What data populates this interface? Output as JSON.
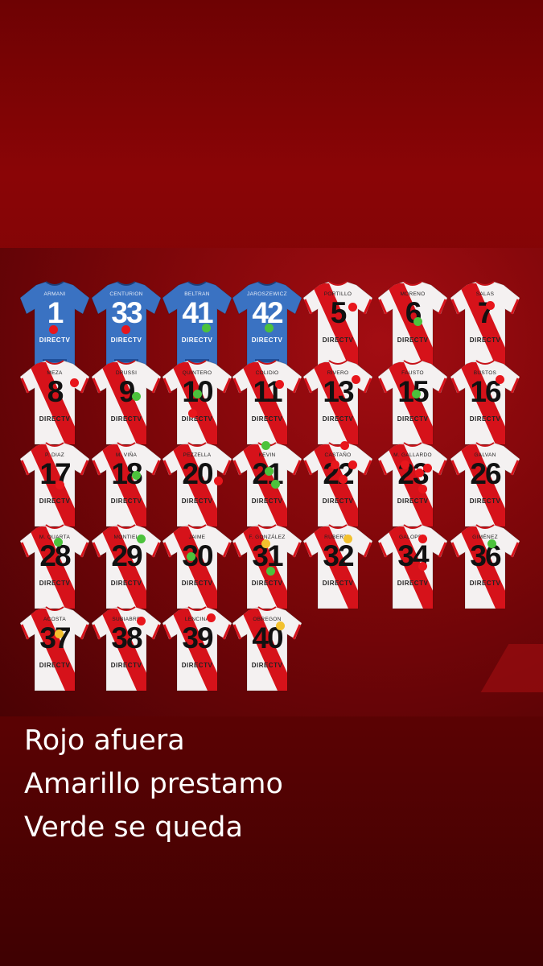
{
  "colors": {
    "red_dot": "#e8161c",
    "yellow_dot": "#f2c12e",
    "green_dot": "#4cc23c",
    "blue_kit": "#3a72c2",
    "white_kit": "#f4f1f1",
    "red_sash": "#d6121a"
  },
  "sponsor": "DIRECTV",
  "legend": {
    "red": "Rojo afuera",
    "yellow": "Amarillo prestamo",
    "green": "Verde se queda"
  },
  "jerseys": [
    {
      "name": "ARMANI",
      "number": "1",
      "kit": "blue",
      "dots": [
        "red"
      ]
    },
    {
      "name": "CENTURION",
      "number": "33",
      "kit": "blue",
      "dots": [
        "red"
      ]
    },
    {
      "name": "BELTRAN",
      "number": "41",
      "kit": "blue",
      "dots": [
        "green"
      ]
    },
    {
      "name": "JAROSZEWICZ",
      "number": "42",
      "kit": "blue",
      "dots": [
        "green"
      ]
    },
    {
      "name": "PORTILLO",
      "number": "5",
      "kit": "white",
      "dots": [
        "red"
      ]
    },
    {
      "name": "MORENO",
      "number": "6",
      "kit": "white",
      "dots": [
        "green"
      ]
    },
    {
      "name": "SALAS",
      "number": "7",
      "kit": "white",
      "dots": [
        "red"
      ]
    },
    {
      "name": "MEZA",
      "number": "8",
      "kit": "white",
      "dots": [
        "red"
      ]
    },
    {
      "name": "DRUSSI",
      "number": "9",
      "kit": "white",
      "dots": [
        "green"
      ]
    },
    {
      "name": "QUINTERO",
      "number": "10",
      "kit": "white",
      "dots": [
        "green",
        "red"
      ]
    },
    {
      "name": "COLIDIO",
      "number": "11",
      "kit": "white",
      "dots": [
        "red"
      ]
    },
    {
      "name": "RIVERO",
      "number": "13",
      "kit": "white",
      "dots": [
        "red"
      ]
    },
    {
      "name": "FAUSTO",
      "number": "15",
      "kit": "white",
      "dots": [
        "green"
      ]
    },
    {
      "name": "BUSTOS",
      "number": "16",
      "kit": "white",
      "dots": [
        "red"
      ]
    },
    {
      "name": "P. DIAZ",
      "number": "17",
      "kit": "white",
      "dots": [
        "red"
      ]
    },
    {
      "name": "M. VIÑA",
      "number": "18",
      "kit": "white",
      "dots": [
        "green"
      ]
    },
    {
      "name": "PEZZELLA",
      "number": "20",
      "kit": "white",
      "dots": [
        "red"
      ]
    },
    {
      "name": "KEVIN",
      "number": "21",
      "kit": "white",
      "dots": [
        "green",
        "green",
        "green"
      ]
    },
    {
      "name": "CASTAÑO",
      "number": "22",
      "kit": "white",
      "dots": [
        "red",
        "red",
        "red",
        "red"
      ]
    },
    {
      "name": "M. GALLARDO",
      "number": "23",
      "kit": "white",
      "dots": [
        "red",
        "red",
        "red",
        "red"
      ]
    },
    {
      "name": "GALVAN",
      "number": "26",
      "kit": "white",
      "dots": []
    },
    {
      "name": "M. QUARTA",
      "number": "28",
      "kit": "white",
      "dots": [
        "green"
      ]
    },
    {
      "name": "MONTIEL",
      "number": "29",
      "kit": "white",
      "dots": [
        "green"
      ]
    },
    {
      "name": "JAIME",
      "number": "30",
      "kit": "white",
      "dots": [
        "green"
      ]
    },
    {
      "name": "F. GONZÁLEZ",
      "number": "31",
      "kit": "white",
      "dots": [
        "yellow",
        "green"
      ]
    },
    {
      "name": "RUBERTO",
      "number": "32",
      "kit": "white",
      "dots": [
        "yellow"
      ]
    },
    {
      "name": "GALOPPO",
      "number": "34",
      "kit": "white",
      "dots": [
        "red",
        "red"
      ]
    },
    {
      "name": "GIMÉNEZ",
      "number": "36",
      "kit": "white",
      "dots": [
        "green"
      ]
    },
    {
      "name": "ACOSTA",
      "number": "37",
      "kit": "white",
      "dots": [
        "yellow"
      ]
    },
    {
      "name": "SUBIABRE",
      "number": "38",
      "kit": "white",
      "dots": [
        "red"
      ]
    },
    {
      "name": "LENCINA",
      "number": "39",
      "kit": "white",
      "dots": [
        "red"
      ]
    },
    {
      "name": "OBREGON",
      "number": "40",
      "kit": "white",
      "dots": [
        "yellow"
      ]
    }
  ]
}
